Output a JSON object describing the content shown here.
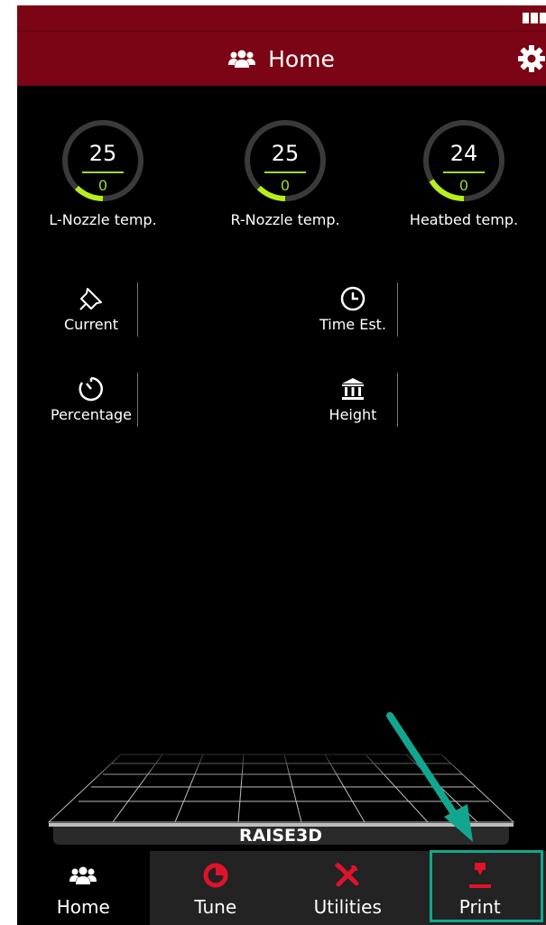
{
  "header": {
    "title": "Home",
    "icon": "users-icon",
    "settings_icon": "gear-icon"
  },
  "colors": {
    "header_bg": "#7b0514",
    "accent_green": "#9edb2c",
    "accent_red": "#e0132b",
    "highlight": "#12a68f"
  },
  "gauges": [
    {
      "label": "L-Nozzle temp.",
      "current": "25",
      "target": "0"
    },
    {
      "label": "R-Nozzle temp.",
      "current": "25",
      "target": "0"
    },
    {
      "label": "Heatbed temp.",
      "current": "24",
      "target": "0"
    }
  ],
  "info": [
    {
      "label": "Current",
      "icon": "pin-icon"
    },
    {
      "label": "Time Est.",
      "icon": "clock-icon"
    },
    {
      "label": "Percentage",
      "icon": "timer-icon"
    },
    {
      "label": "Height",
      "icon": "pillar-icon"
    }
  ],
  "brand": "RAISE3D",
  "tabs": [
    {
      "label": "Home",
      "icon": "users-icon",
      "active": true
    },
    {
      "label": "Tune",
      "icon": "pie-icon",
      "active": false
    },
    {
      "label": "Utilities",
      "icon": "tools-icon",
      "active": false
    },
    {
      "label": "Print",
      "icon": "print-icon",
      "active": false
    }
  ]
}
